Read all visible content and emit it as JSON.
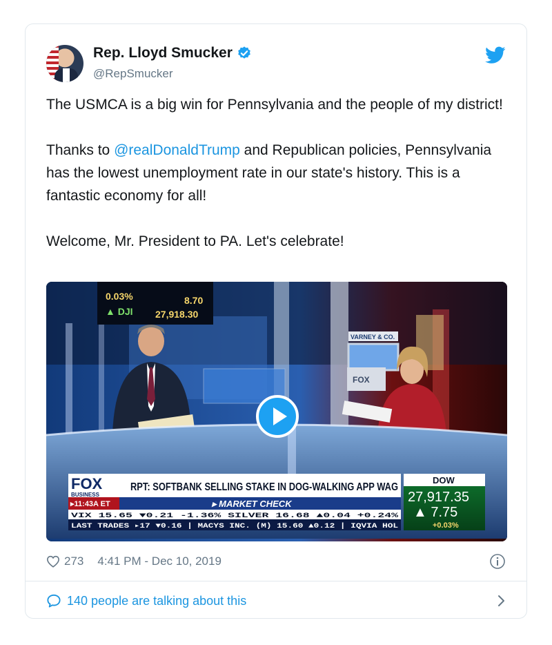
{
  "author": {
    "name": "Rep. Lloyd Smucker",
    "handle": "@RepSmucker",
    "verified": true
  },
  "tweet": {
    "para1": "The USMCA is a big win for Pennsylvania and the people of my district!",
    "para2_prefix": "Thanks to ",
    "mention": "@realDonaldTrump",
    "para2_suffix": " and Republican policies, Pennsylvania has the lowest unemployment rate in our state's history. This is a fantastic economy for all!",
    "para3": "Welcome, Mr. President to PA. Let's celebrate!"
  },
  "video": {
    "ticker_pct": "0.03%",
    "ticker_val1": "8.70",
    "ticker_dji": "▲ DJI",
    "ticker_val2": "27,918.30",
    "screen_label": "FOX",
    "varney_label": "VARNEY & CO.",
    "fox_logo": "FOX",
    "fox_sub": "BUSINESS",
    "time": "▸11:43A ET",
    "headline": "RPT: SOFTBANK SELLING STAKE IN DOG-WALKING APP WAG",
    "segment": "▸ MARKET CHECK",
    "dow_label": "DOW",
    "dow_value": "27,917.35",
    "dow_change": "▲  7.75",
    "dow_pct": "+0.03%",
    "ticker_row1": "VIX          15.65  ▼0.21  -1.36%  SILVER          16.68  ▲0.04  +0.24%",
    "ticker_row2": "LAST TRADES  ▸17  ▼0.16  |  MACYS INC. (M)  15.60  ▲0.12  |  IQVIA HOL"
  },
  "meta": {
    "likes": "273",
    "timestamp": "4:41 PM - Dec 10, 2019"
  },
  "footer": {
    "talking": "140 people are talking about this"
  },
  "colors": {
    "twitter_blue": "#1da1f2",
    "link_blue": "#1b95e0",
    "text": "#14171a",
    "muted": "#657786",
    "border": "#e1e8ed"
  }
}
